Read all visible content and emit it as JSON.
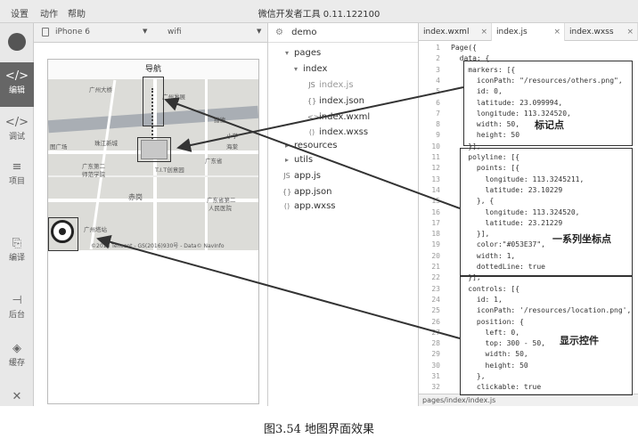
{
  "window": {
    "title": "微信开发者工具 0.11.122100",
    "menu": [
      "设置",
      "动作",
      "帮助"
    ]
  },
  "sidebar": {
    "items": [
      {
        "label": "编辑",
        "icon": "</>",
        "active": true
      },
      {
        "label": "调试",
        "icon": "</>",
        "active": false
      },
      {
        "label": "项目",
        "icon": "≡",
        "active": false
      },
      {
        "label": "编译",
        "icon": "⎘",
        "active": false
      },
      {
        "label": "后台",
        "icon": "⊣",
        "active": false
      },
      {
        "label": "缓存",
        "icon": "◈",
        "active": false
      },
      {
        "label": "关闭",
        "icon": "✕",
        "active": false
      }
    ]
  },
  "device": {
    "model": "iPhone 6",
    "network": "wifi"
  },
  "simulator": {
    "nav_title": "导航",
    "map_labels": [
      "广州大桥",
      "广州发展",
      "猎德",
      "小学",
      "图广场",
      "珠江新城",
      "广东省",
      "广东第二",
      "师范学院",
      "海棠",
      "T.I.T创意园",
      "赤岗",
      "广东省第二",
      "人民医院",
      "广州塔站"
    ],
    "copyright": "©2016 Tencent - GS(2016)930号 - Data© NavInfo"
  },
  "explorer": {
    "project": "demo",
    "tree": [
      {
        "label": "pages",
        "type": "folder",
        "open": true,
        "depth": 0
      },
      {
        "label": "index",
        "type": "folder",
        "open": true,
        "depth": 1
      },
      {
        "label": "index.js",
        "type": "js",
        "depth": 2,
        "dim": true
      },
      {
        "label": "index.json",
        "type": "json",
        "depth": 2
      },
      {
        "label": "index.wxml",
        "type": "wxml",
        "depth": 2
      },
      {
        "label": "index.wxss",
        "type": "wxss",
        "depth": 2
      },
      {
        "label": "resources",
        "type": "folder",
        "open": false,
        "depth": 0
      },
      {
        "label": "utils",
        "type": "folder",
        "open": false,
        "depth": 0
      },
      {
        "label": "app.js",
        "type": "js",
        "depth": 0
      },
      {
        "label": "app.json",
        "type": "json",
        "depth": 0
      },
      {
        "label": "app.wxss",
        "type": "wxss",
        "depth": 0
      }
    ]
  },
  "editor": {
    "tabs": [
      {
        "label": "index.wxml",
        "active": false
      },
      {
        "label": "index.js",
        "active": true
      },
      {
        "label": "index.wxss",
        "active": false
      }
    ],
    "close_glyph": "×",
    "lines": [
      "Page({",
      "  data: {",
      "    markers: [{",
      "      iconPath: \"/resources/others.png\",",
      "      id: 0,",
      "      latitude: 23.099994,",
      "      longitude: 113.324520,",
      "      width: 50,",
      "      height: 50",
      "    }],",
      "    polyline: [{",
      "      points: [{",
      "        longitude: 113.3245211,",
      "        latitude: 23.10229",
      "      }, {",
      "        longitude: 113.324520,",
      "        latitude: 23.21229",
      "      }],",
      "      color:\"#053E37\",",
      "      width: 1,",
      "      dottedLine: true",
      "    }],",
      "    controls: [{",
      "      id: 1,",
      "      iconPath: '/resources/location.png',",
      "      position: {",
      "        left: 0,",
      "        top: 300 - 50,",
      "        width: 50,",
      "        height: 50",
      "      },",
      "      clickable: true",
      "    }]"
    ],
    "status_path": "pages/index/index.js"
  },
  "annotations": {
    "markers_label": "标记点",
    "polyline_label": "一系列坐标点",
    "controls_label": "显示控件"
  },
  "caption": "图3.54    地图界面效果"
}
